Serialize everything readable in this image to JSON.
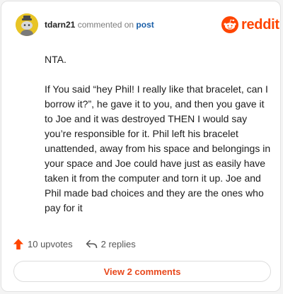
{
  "comment": {
    "username": "tdarn21",
    "action_text": " commented on ",
    "post_link": "post",
    "paragraphs": [
      "NTA.",
      "If You said “hey Phil! I really like that bracelet, can I borrow it?”, he gave it to you, and then you gave it to Joe and it was destroyed THEN I would say you’re responsible for it. Phil left his bracelet unattended, away from his space and belongings in your space and Joe could have just as easily have taken it from the computer and torn it up. Joe and Phil made bad choices and they are the ones who pay for it"
    ]
  },
  "brand": {
    "wordmark": "reddit",
    "color": "#ff4500"
  },
  "actions": {
    "upvotes": "10 upvotes",
    "replies": "2 replies"
  },
  "footer": {
    "view_comments": "View 2 comments"
  },
  "icons": {
    "avatar": "snoo-avatar-icon",
    "logo": "reddit-logo-icon",
    "upvote": "upvote-arrow-icon",
    "reply": "reply-arrow-icon"
  }
}
